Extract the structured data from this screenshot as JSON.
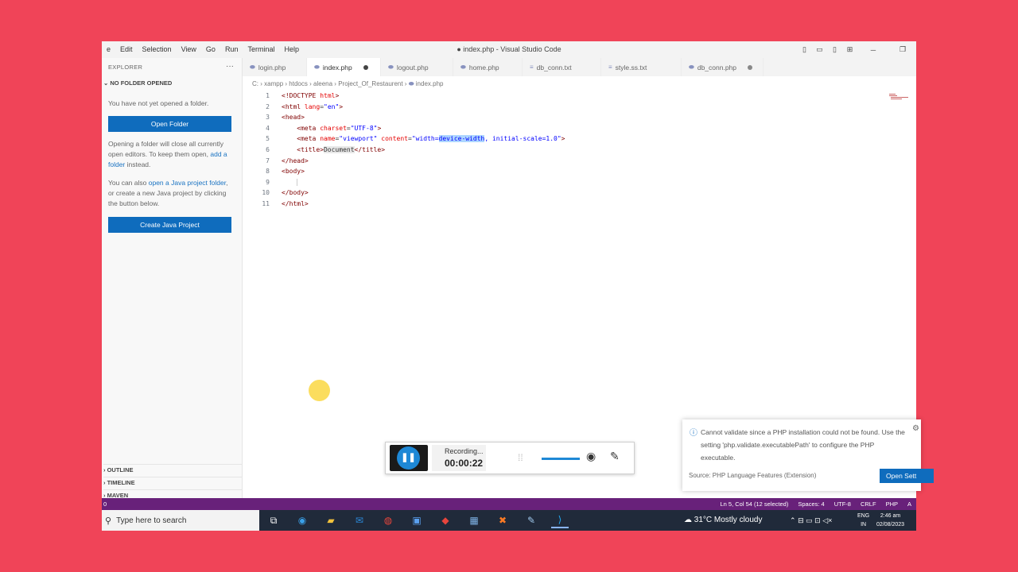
{
  "window": {
    "title": "● index.php - Visual Studio Code",
    "menu": [
      "e",
      "Edit",
      "Selection",
      "View",
      "Go",
      "Run",
      "Terminal",
      "Help"
    ]
  },
  "sidebar": {
    "header": "EXPLORER",
    "section": "NO FOLDER OPENED",
    "text1": "You have not yet opened a folder.",
    "open_folder_button": "Open Folder",
    "text2_a": "Opening a folder will close all currently open editors. To keep them open, ",
    "text2_link": "add a folder",
    "text2_b": " instead.",
    "text3_a": "You can also ",
    "text3_link": "open a Java project folder",
    "text3_b": ", or create a new Java project by clicking the button below.",
    "create_java_button": "Create Java Project",
    "bottom_sections": [
      "OUTLINE",
      "TIMELINE",
      "MAVEN"
    ]
  },
  "tabs": [
    {
      "label": "login.php",
      "active": false,
      "dirty": false
    },
    {
      "label": "index.php",
      "active": true,
      "dirty": true
    },
    {
      "label": "logout.php",
      "active": false,
      "dirty": false
    },
    {
      "label": "home.php",
      "active": false,
      "dirty": false
    },
    {
      "label": "db_conn.txt",
      "active": false,
      "dirty": false
    },
    {
      "label": "style.ss.txt",
      "active": false,
      "dirty": false
    },
    {
      "label": "db_conn.php",
      "active": false,
      "dirty": true
    }
  ],
  "breadcrumb": [
    "C:",
    "xampp",
    "htdocs",
    "aleena",
    "Project_Of_Restaurent",
    "index.php"
  ],
  "code_lines": [
    {
      "n": "1",
      "text": "<!DOCTYPE html>"
    },
    {
      "n": "2",
      "text": "<html lang=\"en\">"
    },
    {
      "n": "3",
      "text": "<head>"
    },
    {
      "n": "4",
      "text": "    <meta charset=\"UTF-8\">"
    },
    {
      "n": "5",
      "text": "    <meta name=\"viewport\" content=\"width=device-width, initial-scale=1.0\">"
    },
    {
      "n": "6",
      "text": "    <title>Document</title>"
    },
    {
      "n": "7",
      "text": "</head>"
    },
    {
      "n": "8",
      "text": "<body>"
    },
    {
      "n": "9",
      "text": "    "
    },
    {
      "n": "10",
      "text": "</body>"
    },
    {
      "n": "11",
      "text": "</html>"
    }
  ],
  "statusbar": {
    "left": "0",
    "items": [
      "Ln 5, Col 54 (12 selected)",
      "Spaces: 4",
      "UTF-8",
      "CRLF",
      "PHP",
      "A"
    ]
  },
  "notification": {
    "message": "Cannot validate since a PHP installation could not be found. Use the setting 'php.validate.executablePath' to configure the PHP executable.",
    "source": "Source: PHP Language Features (Extension)",
    "button": "Open Sett"
  },
  "recorder": {
    "status": "Recording...",
    "time": "00:00:22"
  },
  "taskbar": {
    "search_placeholder": "Type here to search",
    "weather": "31°C  Mostly cloudy",
    "lang1": "ENG",
    "lang2": "IN",
    "time": "2:46 am",
    "date": "02/08/2023"
  },
  "colors": {
    "background": "#f04458",
    "accent_button": "#0f6cbd",
    "statusbar": "#68217a",
    "selection": "#add6ff"
  }
}
